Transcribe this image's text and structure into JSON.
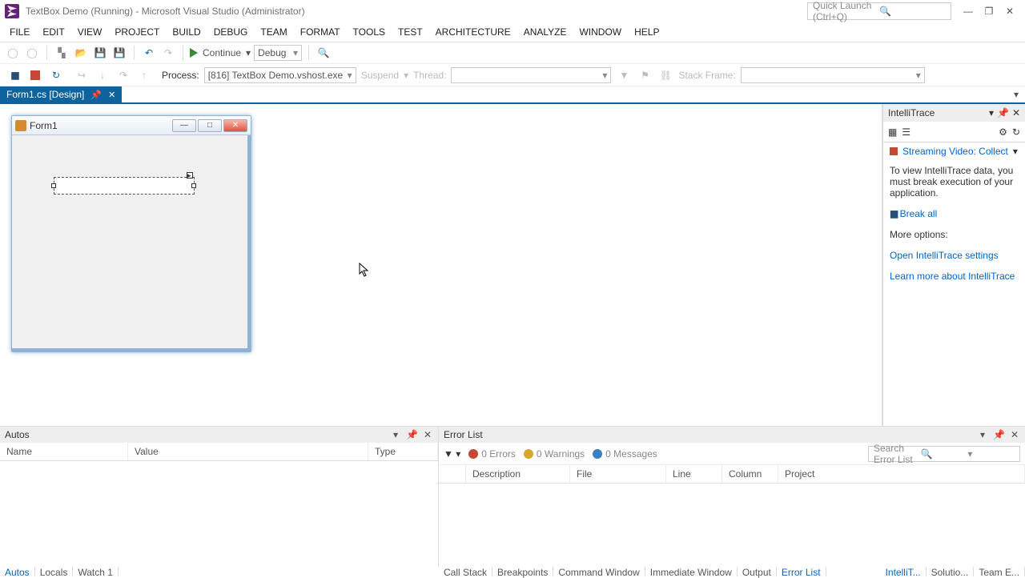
{
  "titlebar": {
    "title": "TextBox Demo (Running) - Microsoft Visual Studio (Administrator)",
    "quick_launch_placeholder": "Quick Launch (Ctrl+Q)"
  },
  "menu": [
    "FILE",
    "EDIT",
    "VIEW",
    "PROJECT",
    "BUILD",
    "DEBUG",
    "TEAM",
    "FORMAT",
    "TOOLS",
    "TEST",
    "ARCHITECTURE",
    "ANALYZE",
    "WINDOW",
    "HELP"
  ],
  "toolbar": {
    "continue_label": "Continue",
    "config": "Debug"
  },
  "debugbar": {
    "process_label": "Process:",
    "process_value": "[816] TextBox Demo.vshost.exe",
    "suspend_label": "Suspend",
    "thread_label": "Thread:",
    "stackframe_label": "Stack Frame:"
  },
  "document_tab": "Form1.cs [Design]",
  "form": {
    "title": "Form1"
  },
  "intellitrace": {
    "title": "IntelliTrace",
    "streaming": "Streaming Video: Collect",
    "info": "To view IntelliTrace data, you must break execution of your application.",
    "break_all": "Break all",
    "more_options": "More options:",
    "open_settings": "Open IntelliTrace settings",
    "learn_more": "Learn more about IntelliTrace"
  },
  "autos": {
    "title": "Autos",
    "cols": {
      "name": "Name",
      "value": "Value",
      "type": "Type"
    },
    "tabs": [
      "Autos",
      "Locals",
      "Watch 1"
    ]
  },
  "errorlist": {
    "title": "Error List",
    "errors": "0 Errors",
    "warnings": "0 Warnings",
    "messages": "0 Messages",
    "search_placeholder": "Search Error List",
    "cols": {
      "description": "Description",
      "file": "File",
      "line": "Line",
      "column": "Column",
      "project": "Project"
    },
    "tabs": [
      "Call Stack",
      "Breakpoints",
      "Command Window",
      "Immediate Window",
      "Output",
      "Error List"
    ]
  },
  "right_tabs": [
    "IntelliT...",
    "Solutio...",
    "Team E..."
  ]
}
